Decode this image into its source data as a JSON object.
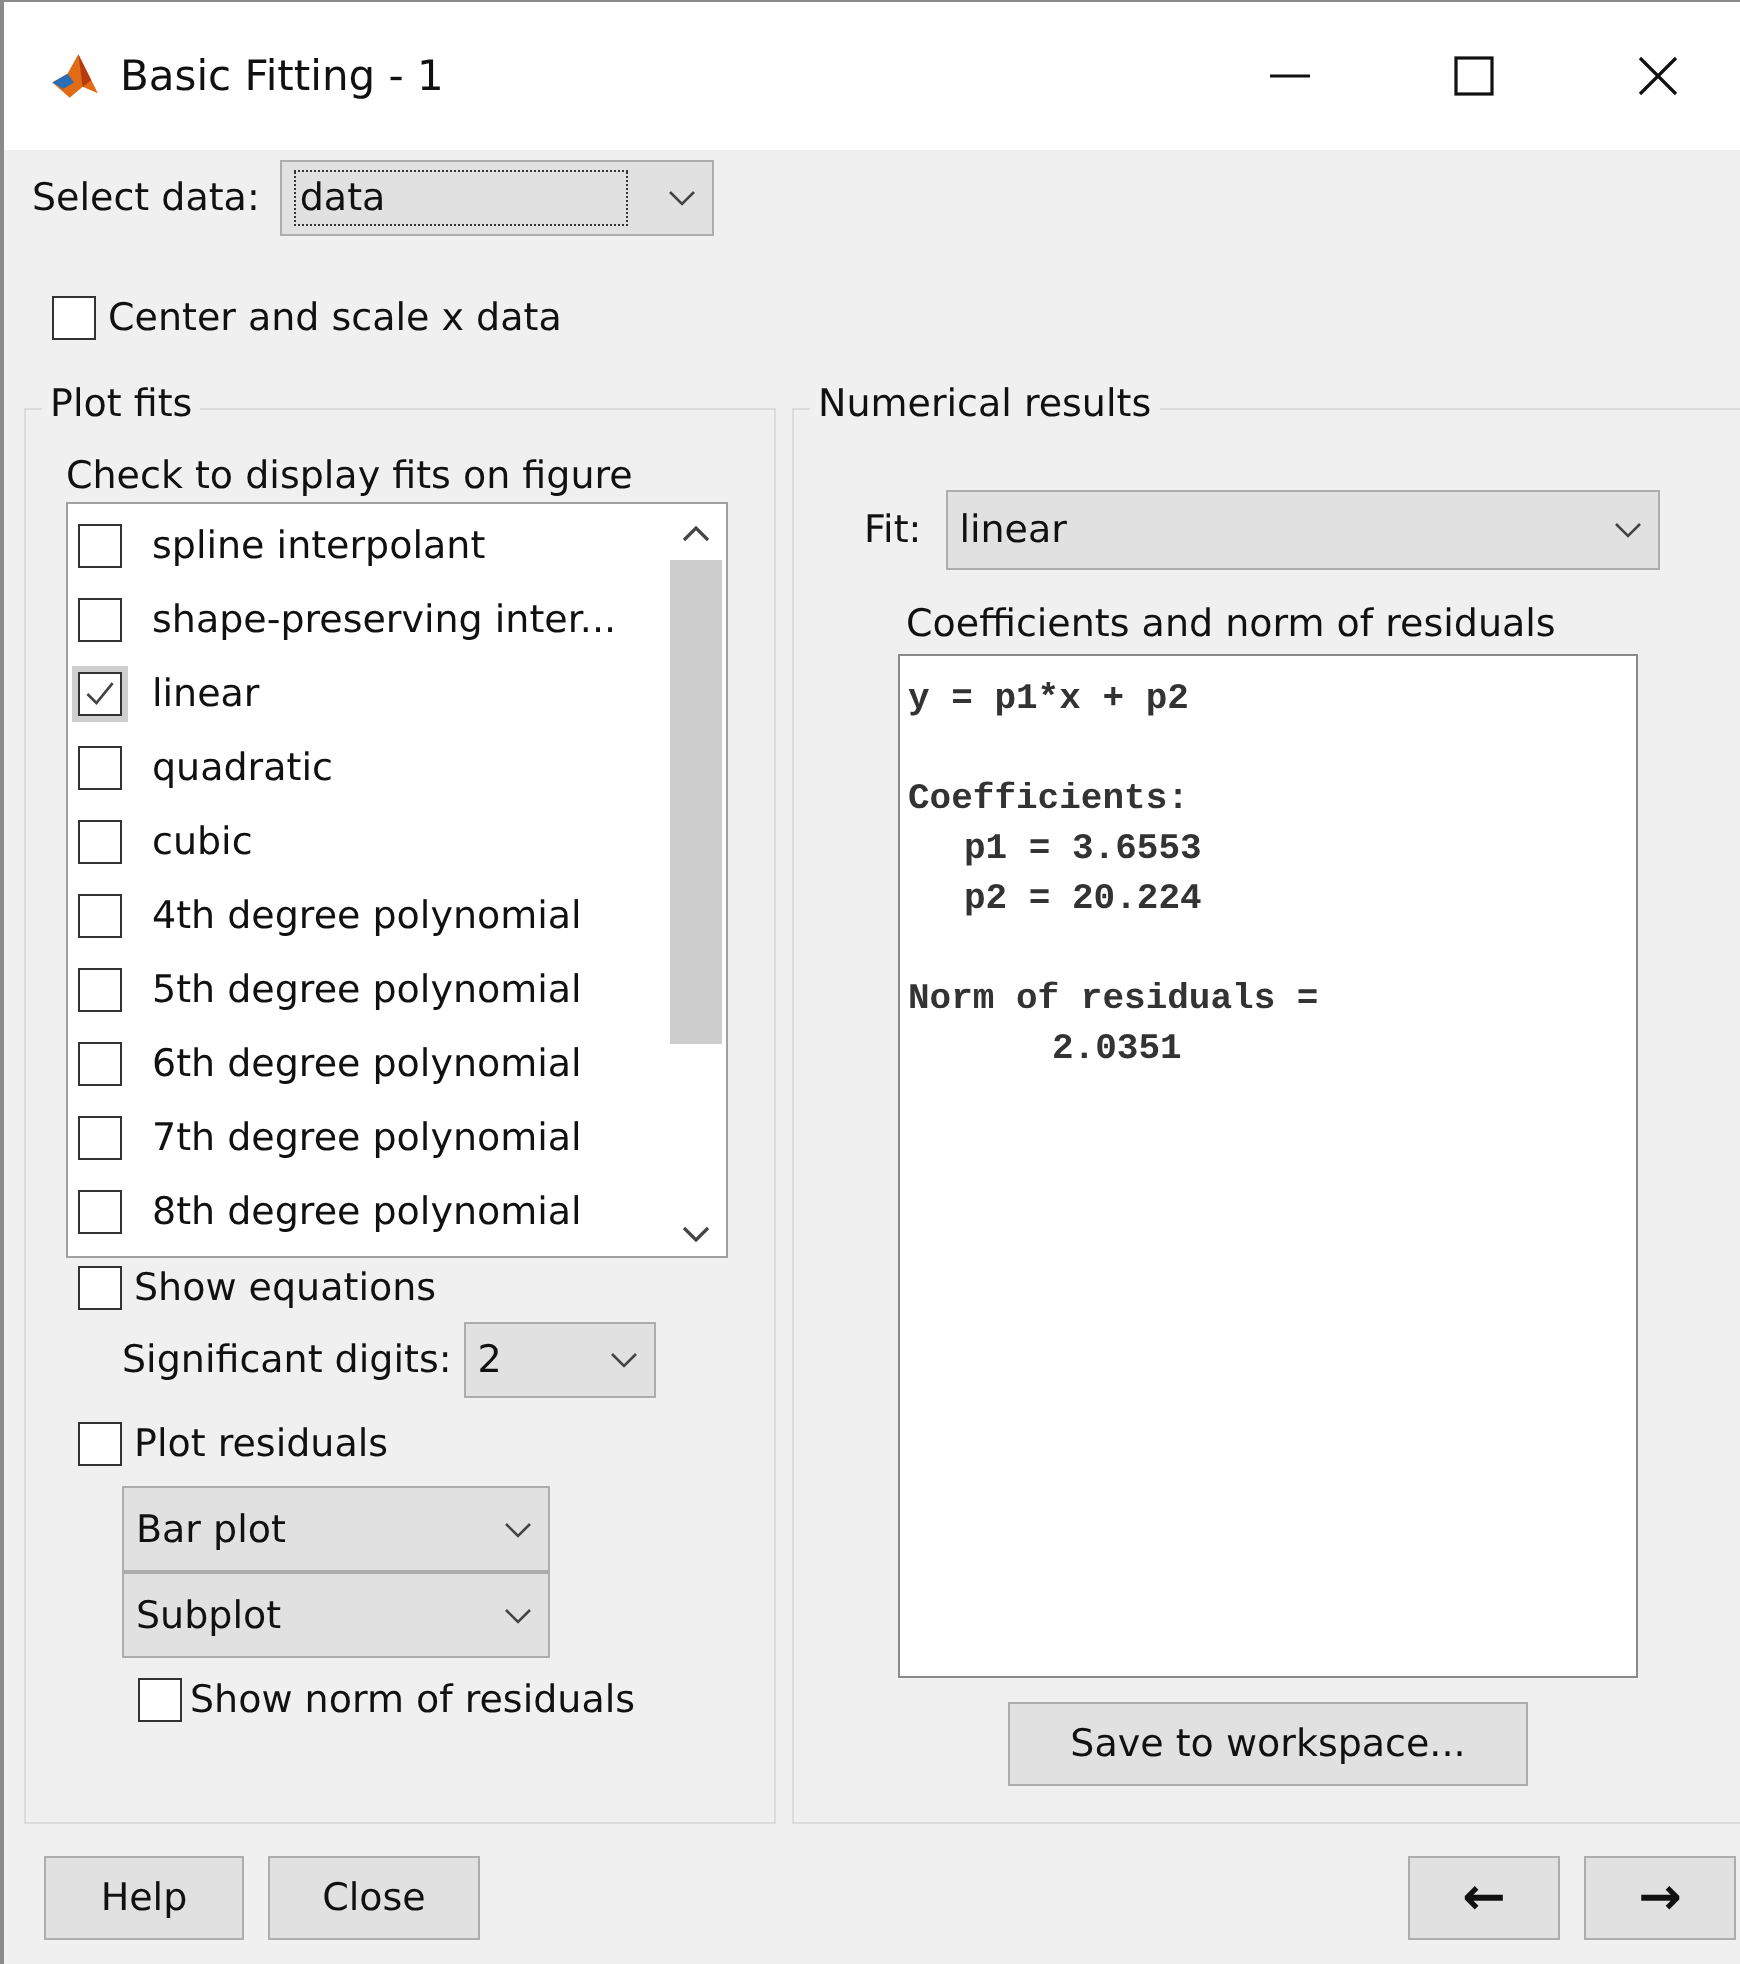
{
  "window": {
    "title": "Basic Fitting - 1"
  },
  "select_data": {
    "label": "Select data:",
    "value": "data"
  },
  "center_scale": {
    "label": "Center and scale x data",
    "checked": false
  },
  "plot_fits": {
    "title": "Plot fits",
    "instruction": "Check to display fits on figure",
    "fits": [
      {
        "label": "spline interpolant",
        "checked": false
      },
      {
        "label": "shape-preserving inter...",
        "checked": false
      },
      {
        "label": "linear",
        "checked": true
      },
      {
        "label": "quadratic",
        "checked": false
      },
      {
        "label": "cubic",
        "checked": false
      },
      {
        "label": "4th degree polynomial",
        "checked": false
      },
      {
        "label": "5th degree polynomial",
        "checked": false
      },
      {
        "label": "6th degree polynomial",
        "checked": false
      },
      {
        "label": "7th degree polynomial",
        "checked": false
      },
      {
        "label": "8th degree polynomial",
        "checked": false
      }
    ],
    "show_equations": {
      "label": "Show equations",
      "checked": false
    },
    "significant_digits": {
      "label": "Significant digits:",
      "value": "2"
    },
    "plot_residuals": {
      "label": "Plot residuals",
      "checked": false
    },
    "residual_plot_type": "Bar plot",
    "residual_layout": "Subplot",
    "show_norm": {
      "label": "Show norm of residuals",
      "checked": false
    }
  },
  "numerical_results": {
    "title": "Numerical results",
    "fit_label": "Fit:",
    "fit_value": "linear",
    "box_label": "Coefficients and norm of residuals",
    "equation": "y = p1*x + p2",
    "coefficients_heading": "Coefficients:",
    "coefficients": [
      "p1 = 3.6553",
      "p2 = 20.224"
    ],
    "norm_label": "Norm of residuals =",
    "norm_value": "2.0351",
    "save_button": "Save to workspace..."
  },
  "buttons": {
    "help": "Help",
    "close": "Close",
    "back": "←",
    "forward": "→"
  }
}
